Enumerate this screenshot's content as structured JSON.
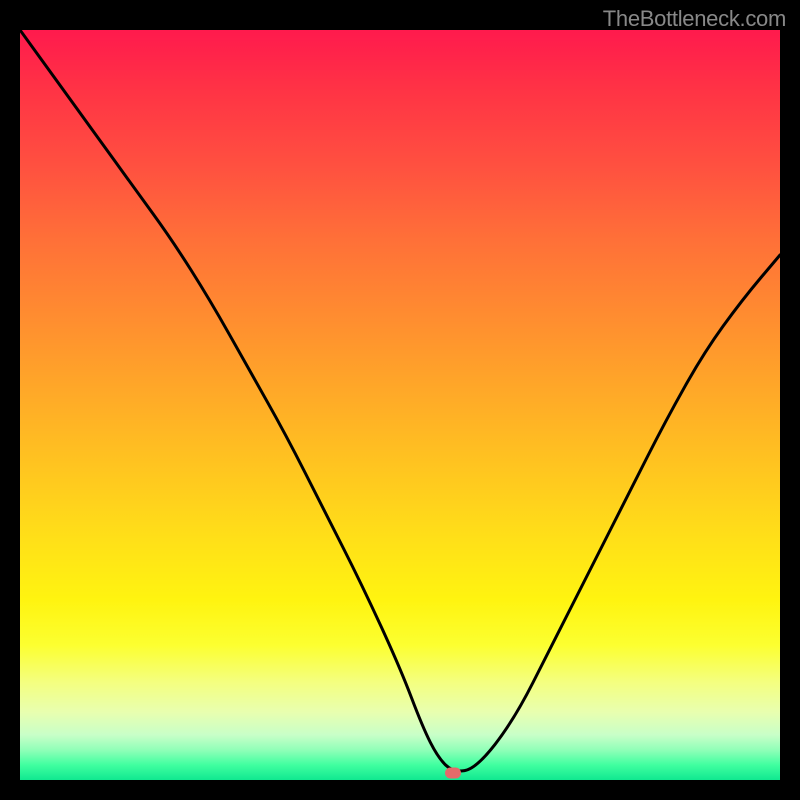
{
  "watermark": "TheBottleneck.com",
  "chart_data": {
    "type": "line",
    "title": "",
    "xlabel": "",
    "ylabel": "",
    "xlim": [
      0,
      100
    ],
    "ylim": [
      0,
      100
    ],
    "x": [
      0,
      5,
      10,
      15,
      20,
      25,
      30,
      35,
      40,
      45,
      50,
      53,
      55,
      57,
      60,
      65,
      70,
      75,
      80,
      85,
      90,
      95,
      100
    ],
    "values": [
      100,
      93,
      86,
      79,
      72,
      64,
      55,
      46,
      36,
      26,
      15,
      7,
      3,
      1,
      1.5,
      8,
      18,
      28,
      38,
      48,
      57,
      64,
      70
    ],
    "marker": {
      "x": 57,
      "y": 1
    },
    "gradient_colors": {
      "top": "#ff1a4d",
      "mid_high": "#ff8c30",
      "mid": "#ffe018",
      "mid_low": "#f4ff80",
      "bottom": "#10e890"
    }
  }
}
